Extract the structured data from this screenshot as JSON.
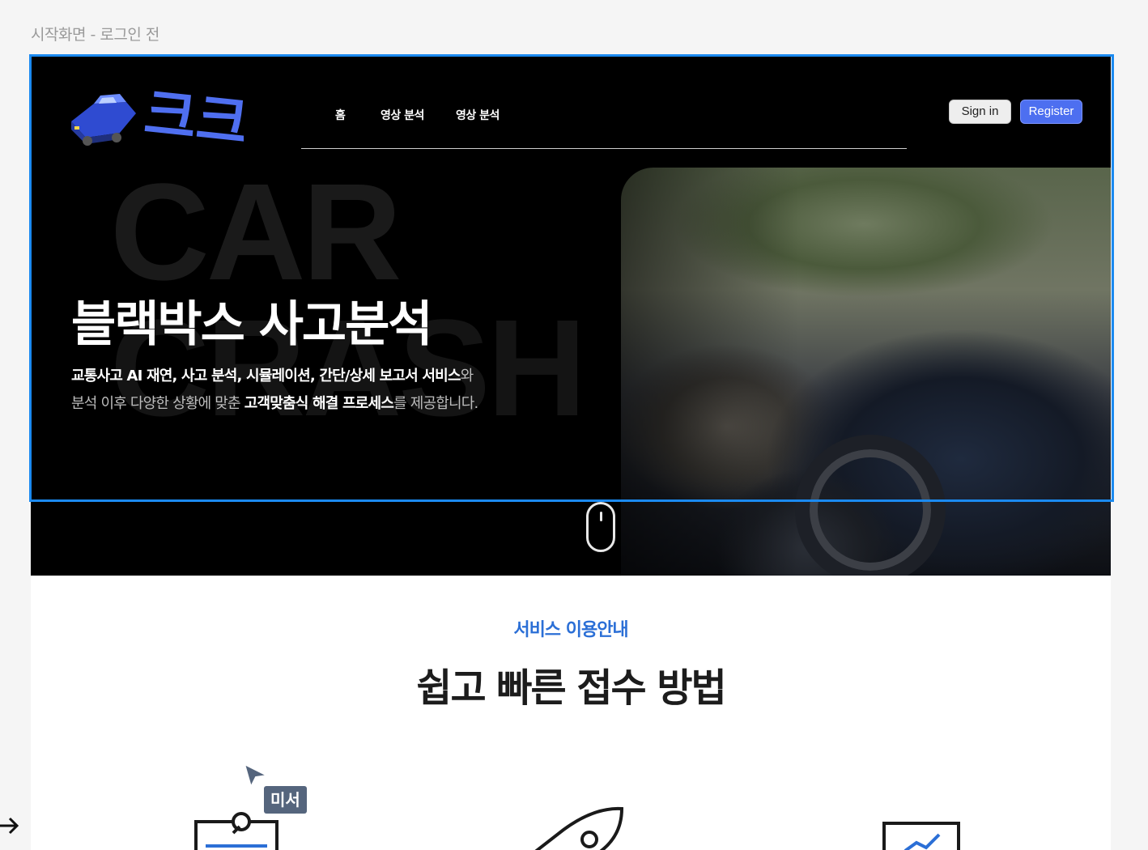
{
  "frame": {
    "label": "시작화면 - 로그인 전"
  },
  "header": {
    "logo_text": "크크",
    "nav": [
      {
        "label": "홈"
      },
      {
        "label": "영상 분석"
      },
      {
        "label": "영상 분석"
      }
    ],
    "sign_in_label": "Sign in",
    "register_label": "Register"
  },
  "hero": {
    "bg_word_1": "CAR",
    "bg_word_2": "CRASH",
    "title": "블랙박스 사고분석",
    "desc_line1_bold": "교통사고 AI 재연, 사고 분석, 시뮬레이션, 간단/상세 보고서 서비스",
    "desc_line1_tail": "와",
    "desc_line2_head": "분석 이후 다양한 상황에 맞춘 ",
    "desc_line2_bold": "고객맞춤식 해결 프로세스",
    "desc_line2_tail": "를 제공합니다."
  },
  "service": {
    "tag": "서비스 이용안내",
    "title": "쉽고 빠른 접수 방법",
    "icons": [
      "clipboard-icon",
      "rocket-icon",
      "chart-icon"
    ]
  },
  "collab": {
    "cursor_name": "미서"
  },
  "colors": {
    "accent": "#2b6fd6",
    "register": "#4d6ff0",
    "selection": "#1b8af0",
    "logo": "#4f6ff0"
  }
}
